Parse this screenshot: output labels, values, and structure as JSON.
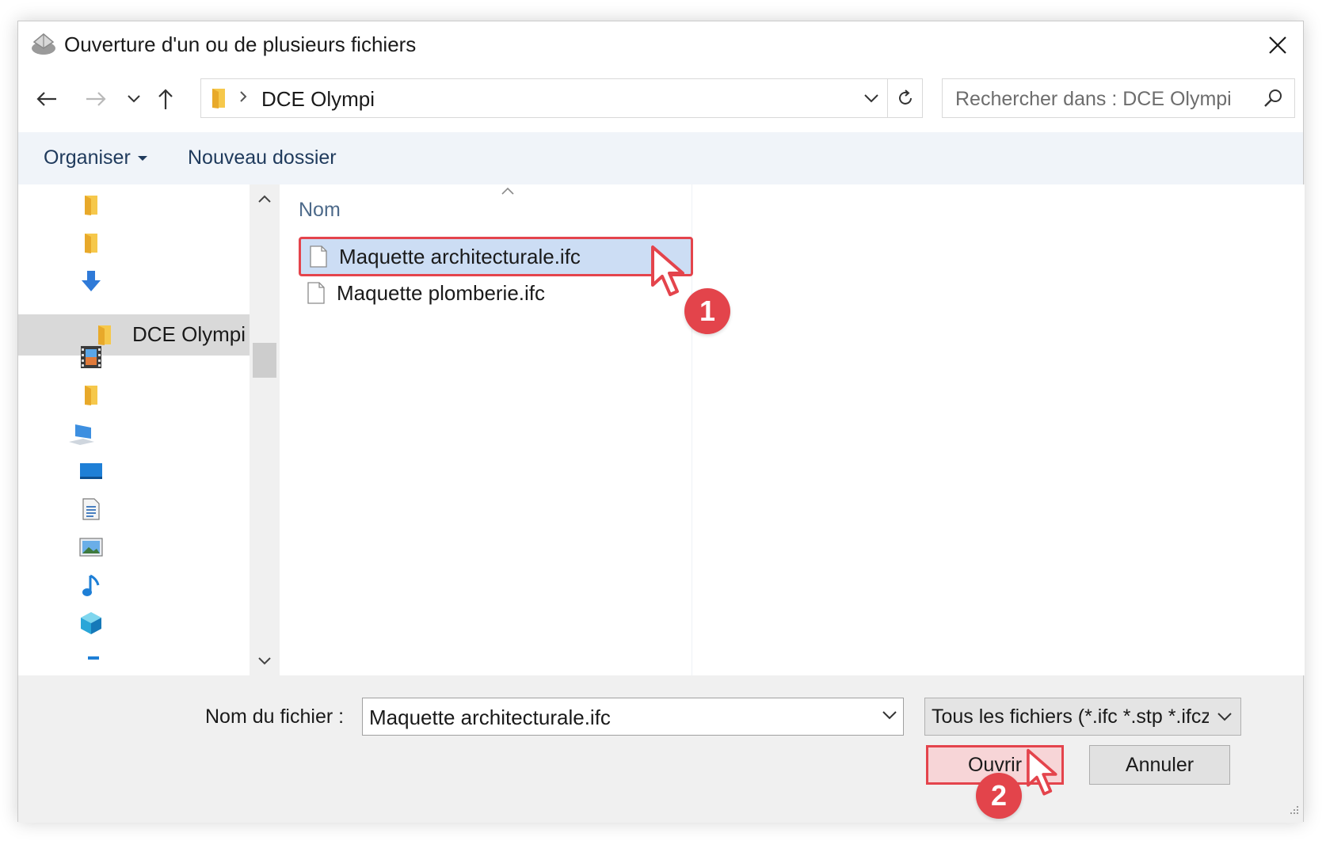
{
  "window": {
    "title": "Ouverture d'un ou de plusieurs fichiers",
    "icons": {
      "app": "app-icon",
      "close": "close-icon"
    }
  },
  "navigation": {
    "back_icon": "arrow-left-icon",
    "forward_icon": "arrow-right-icon",
    "recent_icon": "chevron-down-icon",
    "up_icon": "arrow-up-icon",
    "address": {
      "path": [
        "DCE Olympi"
      ],
      "current": "DCE Olympi"
    },
    "refresh_icon": "refresh-icon",
    "search": {
      "placeholder": "Rechercher dans : DCE Olympi",
      "icon": "search-icon"
    }
  },
  "toolbar": {
    "organize_label": "Organiser",
    "new_folder_label": "Nouveau dossier"
  },
  "sidebar": {
    "items": [
      {
        "icon": "folder-icon",
        "label": ""
      },
      {
        "icon": "folder-icon",
        "label": ""
      },
      {
        "icon": "downloads-icon",
        "label": ""
      },
      {
        "icon": "folder-icon",
        "label": "DCE Olympi",
        "selected": true
      },
      {
        "icon": "videos-icon",
        "label": ""
      },
      {
        "icon": "folder-icon",
        "label": ""
      },
      {
        "icon": "this-pc-icon",
        "label": ""
      },
      {
        "icon": "desktop-icon",
        "label": ""
      },
      {
        "icon": "documents-icon",
        "label": ""
      },
      {
        "icon": "pictures-icon",
        "label": ""
      },
      {
        "icon": "music-icon",
        "label": ""
      },
      {
        "icon": "3d-objects-icon",
        "label": ""
      }
    ]
  },
  "files": {
    "column_name": "Nom",
    "items": [
      {
        "name": "Maquette architecturale.ifc",
        "selected": true
      },
      {
        "name": "Maquette plomberie.ifc",
        "selected": false
      }
    ]
  },
  "footer": {
    "filename_label": "Nom du fichier :",
    "filename_value": "Maquette architecturale.ifc",
    "filter_value": "Tous les fichiers (*.ifc *.stp *.ifcz",
    "open_label": "Ouvrir",
    "cancel_label": "Annuler"
  },
  "annotations": {
    "step1": "1",
    "step2": "2"
  },
  "colors": {
    "highlight": "#e4444c",
    "selection": "#ccddf4",
    "toolbar_bg": "#f0f4f9",
    "badge": "#e3444b"
  }
}
